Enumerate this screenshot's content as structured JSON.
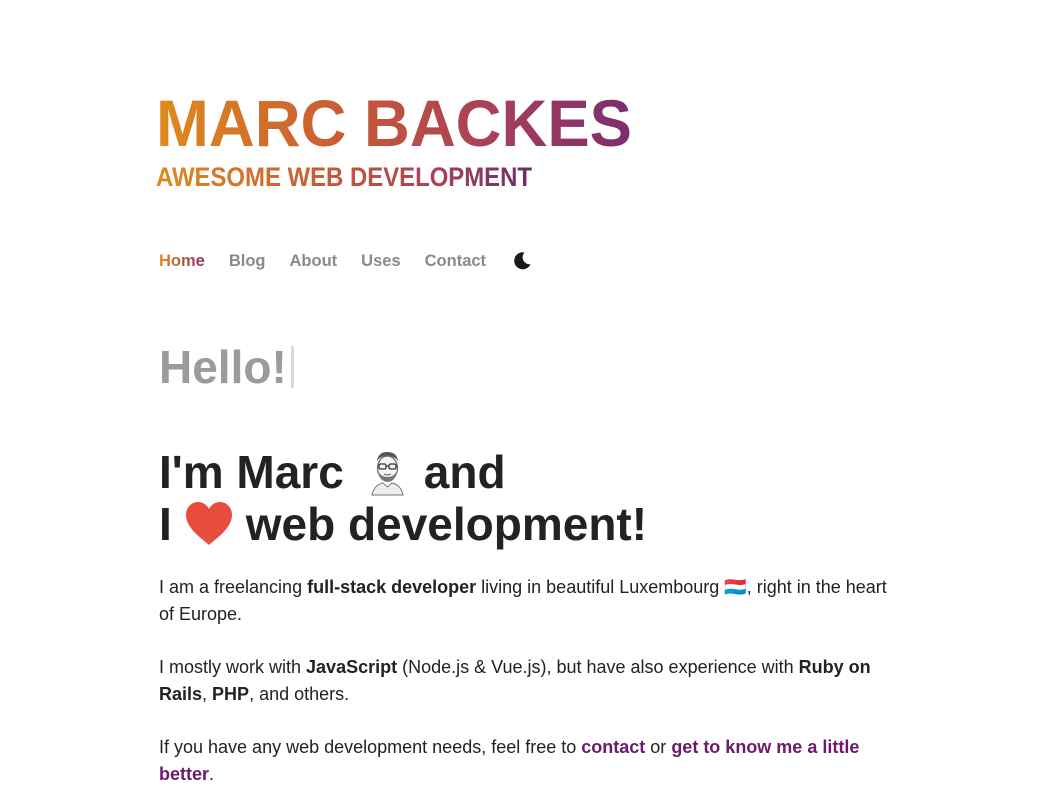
{
  "logo": {
    "name": "MARC BACKES",
    "tagline": "AWESOME WEB DEVELOPMENT",
    "gradient": [
      "#e08a1e",
      "#c85a35",
      "#a8405a",
      "#7a2d6e"
    ]
  },
  "nav": {
    "items": [
      {
        "label": "Home",
        "active": true
      },
      {
        "label": "Blog",
        "active": false
      },
      {
        "label": "About",
        "active": false
      },
      {
        "label": "Uses",
        "active": false
      },
      {
        "label": "Contact",
        "active": false
      }
    ],
    "theme_toggle_icon": "moon-icon"
  },
  "hero": {
    "greeting": "Hello!",
    "line1_a": "I'm Marc",
    "line1_b": "and",
    "line2_a": "I",
    "line2_b": "web development!",
    "avatar_icon": "avatar-illustration",
    "heart_icon": "heart-icon",
    "heart_color": "#e74c3c"
  },
  "content": {
    "p1": {
      "t1": "I am a freelancing ",
      "b1": "full-stack developer",
      "t2": " living in beautiful Luxembourg 🇱🇺, right in the heart of Europe."
    },
    "p2": {
      "t1": "I mostly work with ",
      "b1": "JavaScript",
      "t2": " (Node.js & Vue.js), but have also experience with ",
      "b2": "Ruby on Rails",
      "t3": ", ",
      "b3": "PHP",
      "t4": ", and others."
    },
    "p3": {
      "t1": "If you have any web development needs, feel free to ",
      "link1": "contact",
      "t2": " or ",
      "link2": "get to know me a little better",
      "t3": "."
    },
    "link_color": "#6a1b6e"
  }
}
